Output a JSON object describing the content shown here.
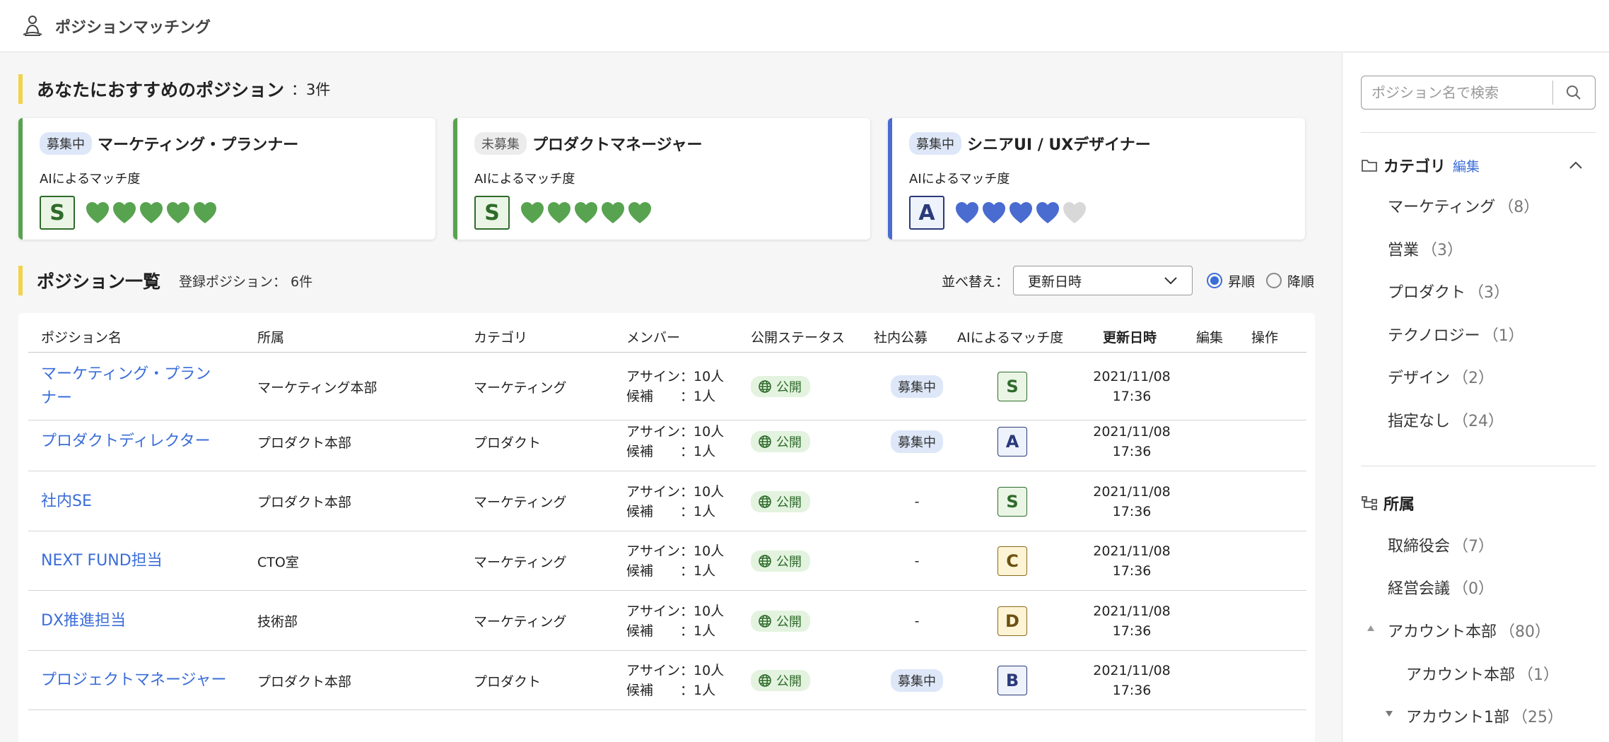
{
  "app": {
    "title": "ポジションマッチング",
    "icon": "person-meditation-icon"
  },
  "recommend": {
    "heading": "あなたにおすすめのポジション",
    "count": "：3件",
    "ai_label": "AIによるマッチ度",
    "cards": [
      {
        "status": "募集中",
        "title": "マーケティング・プランナー",
        "grade": "S",
        "hearts_filled": 5,
        "hearts_total": 5,
        "color": "#58a34f"
      },
      {
        "status": "未募集",
        "title": "プロダクトマネージャー",
        "grade": "S",
        "hearts_filled": 5,
        "hearts_total": 5,
        "color": "#58a34f"
      },
      {
        "status": "募集中",
        "title": "シニアUI / UXデザイナー",
        "grade": "A",
        "hearts_filled": 4,
        "hearts_total": 5,
        "color": "#4a6bd0"
      }
    ]
  },
  "list": {
    "heading": "ポジション一覧",
    "registered": "登録ポジション： 6件",
    "sort_label": "並べ替え：",
    "sort_value": "更新日時",
    "order_asc": "昇順",
    "order_desc": "降順",
    "order_selected": "asc",
    "columns": [
      "ポジション名",
      "所属",
      "カテゴリ",
      "メンバー",
      "公開ステータス",
      "社内公募",
      "AIによるマッチ度",
      "更新日時",
      "編集",
      "操作"
    ],
    "rows": [
      {
        "name_l1": "マーケティング・プラン",
        "name_l2": "ナー",
        "dept": "マーケティング本部",
        "category": "マーケティング",
        "assign": "アサイン：10人",
        "candidate": "候補　　：1人",
        "status": "公開",
        "recruit": "募集中",
        "grade": "S",
        "date": "2021/11/08",
        "time": "17:36"
      },
      {
        "name_l1": "プロダクトディレクター",
        "name_l2": "",
        "dept": "プロダクト本部",
        "category": "プロダクト",
        "assign": "アサイン：10人",
        "candidate": "候補　　：1人",
        "status": "公開",
        "recruit": "募集中",
        "grade": "A",
        "date": "2021/11/08",
        "time": "17:36"
      },
      {
        "name_l1": "社内SE",
        "name_l2": "",
        "dept": "プロダクト本部",
        "category": "マーケティング",
        "assign": "アサイン：10人",
        "candidate": "候補　　：1人",
        "status": "公開",
        "recruit": "-",
        "grade": "S",
        "date": "2021/11/08",
        "time": "17:36"
      },
      {
        "name_l1": "NEXT FUND担当",
        "name_l2": "",
        "dept": "CTO室",
        "category": "マーケティング",
        "assign": "アサイン：10人",
        "candidate": "候補　　：1人",
        "status": "公開",
        "recruit": "-",
        "grade": "C",
        "date": "2021/11/08",
        "time": "17:36"
      },
      {
        "name_l1": "DX推進担当",
        "name_l2": "",
        "dept": "技術部",
        "category": "マーケティング",
        "assign": "アサイン：10人",
        "candidate": "候補　　：1人",
        "status": "公開",
        "recruit": "-",
        "grade": "D",
        "date": "2021/11/08",
        "time": "17:36"
      },
      {
        "name_l1": "プロジェクトマネージャー",
        "name_l2": "",
        "dept": "プロダクト本部",
        "category": "プロダクト",
        "assign": "アサイン：10人",
        "candidate": "候補　　：1人",
        "status": "公開",
        "recruit": "募集中",
        "grade": "B",
        "date": "2021/11/08",
        "time": "17:36"
      }
    ]
  },
  "sidebar": {
    "search_placeholder": "ポジション名で検索",
    "category_heading": "カテゴリ",
    "category_edit": "編集",
    "categories": [
      {
        "label": "マーケティング",
        "count": "（8）"
      },
      {
        "label": "営業",
        "count": "（3）"
      },
      {
        "label": "プロダクト",
        "count": "（3）"
      },
      {
        "label": "テクノロジー",
        "count": "（1）"
      },
      {
        "label": "デザイン",
        "count": "（2）"
      },
      {
        "label": "指定なし",
        "count": "（24）"
      }
    ],
    "org_heading": "所属",
    "orgs": [
      {
        "label": "取締役会",
        "count": "（7）"
      },
      {
        "label": "経営会議",
        "count": "（0）"
      },
      {
        "label": "アカウント本部",
        "count": "（80）"
      },
      {
        "label": "アカウント本部",
        "count": "（1）"
      },
      {
        "label": "アカウント1部",
        "count": "（25）"
      }
    ]
  }
}
